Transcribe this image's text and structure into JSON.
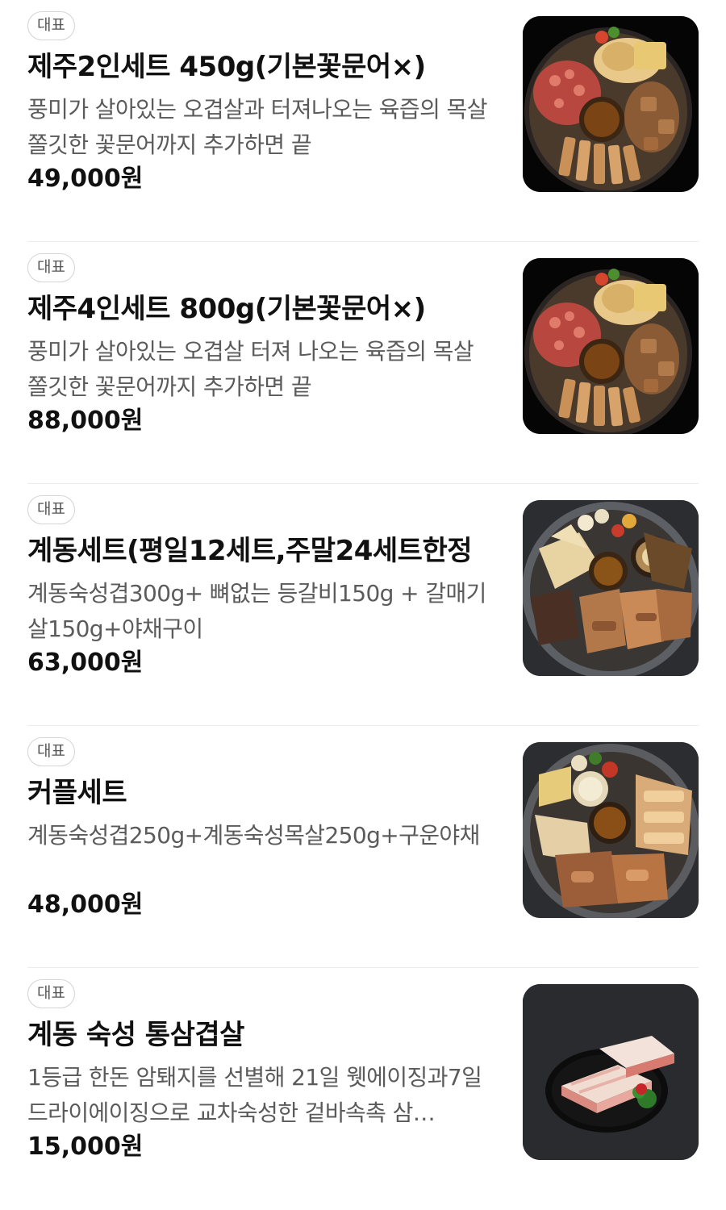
{
  "menu": {
    "items": [
      {
        "badge": "대표",
        "name": "제주2인세트 450g(기본꽃문어×)",
        "description": "풍미가 살아있는 오겹살과 터져나오는 육즙의 목살 쫄깃한 꽃문어까지 추가하면 끝",
        "price": "49,000원",
        "image_icon": "food-photo-icon"
      },
      {
        "badge": "대표",
        "name": "제주4인세트 800g(기본꽃문어×)",
        "description": "풍미가 살아있는 오겹살 터져 나오는 육즙의 목살 쫄깃한 꽃문어까지 추가하면 끝",
        "price": "88,000원",
        "image_icon": "food-photo-icon"
      },
      {
        "badge": "대표",
        "name": "계동세트(평일12세트,주말24세트한정",
        "description": "계동숙성겹300g+ 뼈없는 등갈비150g + 갈매기살150g+야채구이",
        "price": "63,000원",
        "image_icon": "food-photo-icon"
      },
      {
        "badge": "대표",
        "name": "커플세트",
        "description": "계동숙성겹250g+계동숙성목살250g+구운야채",
        "price": "48,000원",
        "image_icon": "food-photo-icon"
      },
      {
        "badge": "대표",
        "name": "계동 숙성 통삼겹살",
        "description": "1등급 한돈 암퇘지를 선별해 21일 웻에이징과7일드라이에이징으로 교차숙성한 겉바속촉 삼…",
        "price": "15,000원",
        "image_icon": "food-photo-icon"
      }
    ]
  }
}
